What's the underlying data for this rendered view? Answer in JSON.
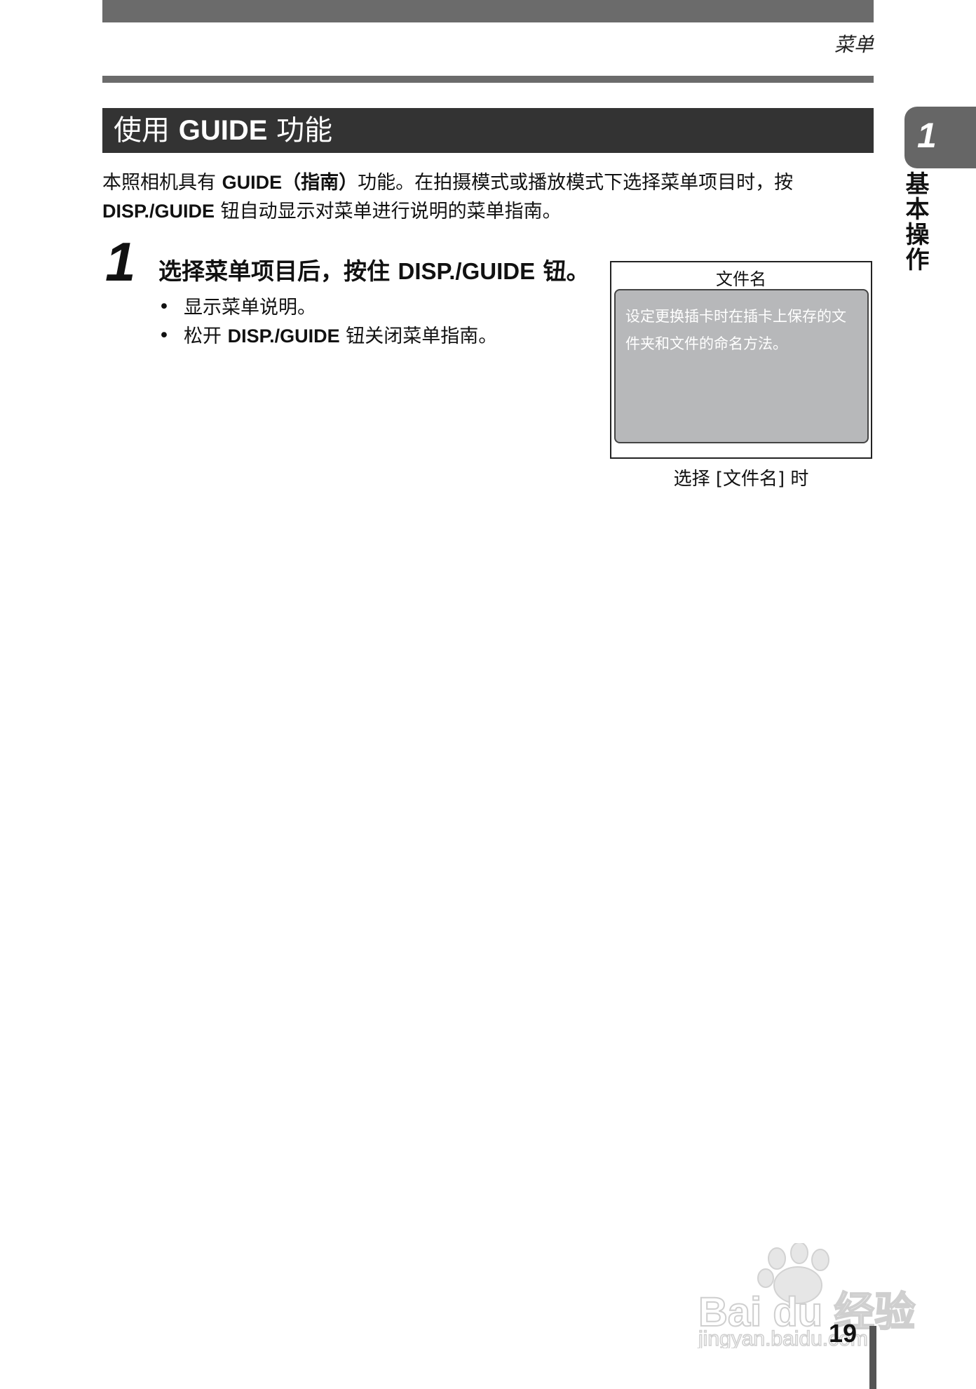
{
  "header": {
    "running_title": "菜单"
  },
  "section": {
    "title_prefix": "使用",
    "title_bold": "GUIDE",
    "title_suffix": "功能"
  },
  "chapter_tab": {
    "number": "1",
    "label": "基本操作"
  },
  "intro": {
    "t1": "本照相机具有 ",
    "b1": "GUIDE",
    "b2": "（指南）",
    "t2": "功能。在拍摄模式或播放模式下选择菜单项目时，按",
    "b3": "DISP./GUIDE",
    "t3": " 钮自动显示对菜单进行说明的菜单指南。"
  },
  "step": {
    "number": "1",
    "heading_pre": "选择菜单项目后，按住 ",
    "heading_bold": "DISP./GUIDE",
    "heading_post": " 钮。",
    "bullets": [
      {
        "pre": "显示菜单说明。",
        "bold": "",
        "post": ""
      },
      {
        "pre": "松开 ",
        "bold": "DISP./GUIDE",
        "post": " 钮关闭菜单指南。"
      }
    ]
  },
  "screen": {
    "title": "文件名",
    "text": "设定更换插卡时在插卡上保存的文件夹和文件的命名方法。",
    "caption": "选择 [文件名] 时"
  },
  "page": {
    "number": "19"
  },
  "watermark": {
    "brand": "Bai du 经验",
    "url": "jingyan.baidu.com"
  }
}
